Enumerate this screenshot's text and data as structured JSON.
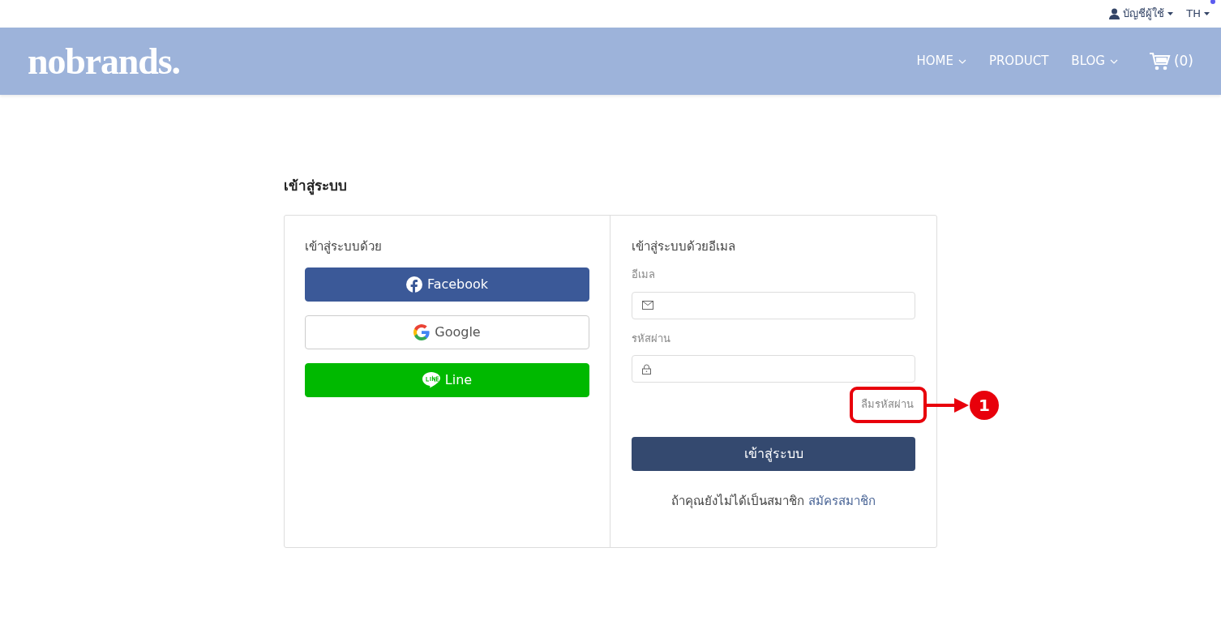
{
  "topbar": {
    "account": "บัญชีผู้ใช้",
    "language": "TH"
  },
  "header": {
    "logo": "nobrands.",
    "nav": [
      {
        "label": "HOME",
        "has_dropdown": true
      },
      {
        "label": "PRODUCT",
        "has_dropdown": false
      },
      {
        "label": "BLOG",
        "has_dropdown": true
      }
    ],
    "cart": "(0)"
  },
  "page_title": "เข้าสู่ระบบ",
  "social": {
    "heading": "เข้าสู่ระบบด้วย",
    "buttons": [
      {
        "kind": "facebook",
        "label": "Facebook"
      },
      {
        "kind": "google",
        "label": "Google"
      },
      {
        "kind": "line",
        "label": "Line"
      }
    ]
  },
  "email_login": {
    "heading": "เข้าสู่ระบบด้วยอีเมล",
    "fields": [
      {
        "kind": "email",
        "label": "อีเมล"
      },
      {
        "kind": "password",
        "label": "รหัสผ่าน"
      }
    ],
    "forgot": "ลืมรหัสผ่าน",
    "submit": "เข้าสู่ระบบ",
    "register_prompt": "ถ้าคุณยังไม่ได้เป็นสมาชิก",
    "register_link": "สมัครสมาชิก"
  },
  "annotation": {
    "number": "1"
  }
}
